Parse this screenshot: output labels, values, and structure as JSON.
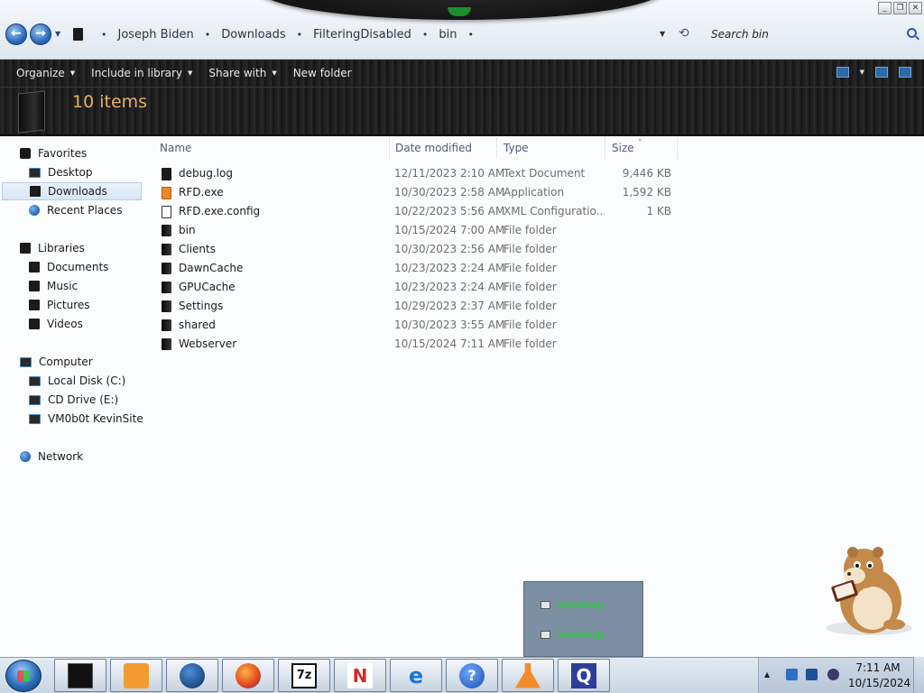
{
  "window": {
    "controls": [
      "minimize",
      "restore",
      "close"
    ]
  },
  "address": {
    "breadcrumbs": [
      "Joseph Biden",
      "Downloads",
      "FilteringDisabled",
      "bin"
    ],
    "search_placeholder": "Search bin",
    "icons": [
      "back-arrow-icon",
      "forward-arrow-icon",
      "refresh-icon",
      "search-icon"
    ]
  },
  "toolbar": {
    "organize": "Organize",
    "include_in_library": "Include in library",
    "share_with": "Share with",
    "new_folder": "New folder"
  },
  "header": {
    "item_count": "10 items"
  },
  "nav": {
    "favorites": "Favorites",
    "desktop": "Desktop",
    "downloads": "Downloads",
    "recent_places": "Recent Places",
    "libraries": "Libraries",
    "documents": "Documents",
    "music": "Music",
    "pictures": "Pictures",
    "videos": "Videos",
    "computer": "Computer",
    "local_disk": "Local Disk (C:)",
    "cd_drive": "CD Drive (E:)",
    "network_share": "VM0b0t KevinSite",
    "network": "Network",
    "selected": "Downloads"
  },
  "columns": {
    "name": "Name",
    "date_modified": "Date modified",
    "type": "Type",
    "size": "Size"
  },
  "files": [
    {
      "name": "debug.log",
      "date": "12/11/2023 2:10 AM",
      "type": "Text Document",
      "size": "9,446 KB",
      "icon": "text-file-icon"
    },
    {
      "name": "RFD.exe",
      "date": "10/30/2023 2:58 AM",
      "type": "Application",
      "size": "1,592 KB",
      "icon": "application-icon"
    },
    {
      "name": "RFD.exe.config",
      "date": "10/22/2023 5:56 AM",
      "type": "XML Configuratio...",
      "size": "1 KB",
      "icon": "config-file-icon"
    },
    {
      "name": "bin",
      "date": "10/15/2024 7:00 AM",
      "type": "File folder",
      "size": "",
      "icon": "folder-icon"
    },
    {
      "name": "Clients",
      "date": "10/30/2023 2:56 AM",
      "type": "File folder",
      "size": "",
      "icon": "folder-icon"
    },
    {
      "name": "DawnCache",
      "date": "10/23/2023 2:24 AM",
      "type": "File folder",
      "size": "",
      "icon": "folder-icon"
    },
    {
      "name": "GPUCache",
      "date": "10/23/2023 2:24 AM",
      "type": "File folder",
      "size": "",
      "icon": "folder-icon"
    },
    {
      "name": "Settings",
      "date": "10/29/2023 2:37 AM",
      "type": "File folder",
      "size": "",
      "icon": "folder-icon"
    },
    {
      "name": "shared",
      "date": "10/30/2023 3:55 AM",
      "type": "File folder",
      "size": "",
      "icon": "folder-icon"
    },
    {
      "name": "Webserver",
      "date": "10/15/2024 7:11 AM",
      "type": "File folder",
      "size": "",
      "icon": "folder-icon"
    }
  ],
  "popup": {
    "items": [
      "UseAmp",
      "UseAmp"
    ]
  },
  "taskbar": {
    "apps": [
      {
        "name": "explorer-app",
        "glyph": ""
      },
      {
        "name": "media-player-app",
        "glyph": ""
      },
      {
        "name": "globe-app",
        "glyph": ""
      },
      {
        "name": "firefox-app",
        "glyph": ""
      },
      {
        "name": "7zip-app",
        "glyph": "7z"
      },
      {
        "name": "n-app",
        "glyph": "N"
      },
      {
        "name": "internet-explorer-app",
        "glyph": "e"
      },
      {
        "name": "help-app",
        "glyph": "?"
      },
      {
        "name": "flask-app",
        "glyph": ""
      },
      {
        "name": "q-app",
        "glyph": "Q"
      }
    ],
    "clock_time": "7:11 AM",
    "clock_date": "10/15/2024"
  },
  "colors": {
    "accent_count": "#e2b06a",
    "popup_text": "#2ecc40",
    "command_bar": "#1d1d1d"
  }
}
